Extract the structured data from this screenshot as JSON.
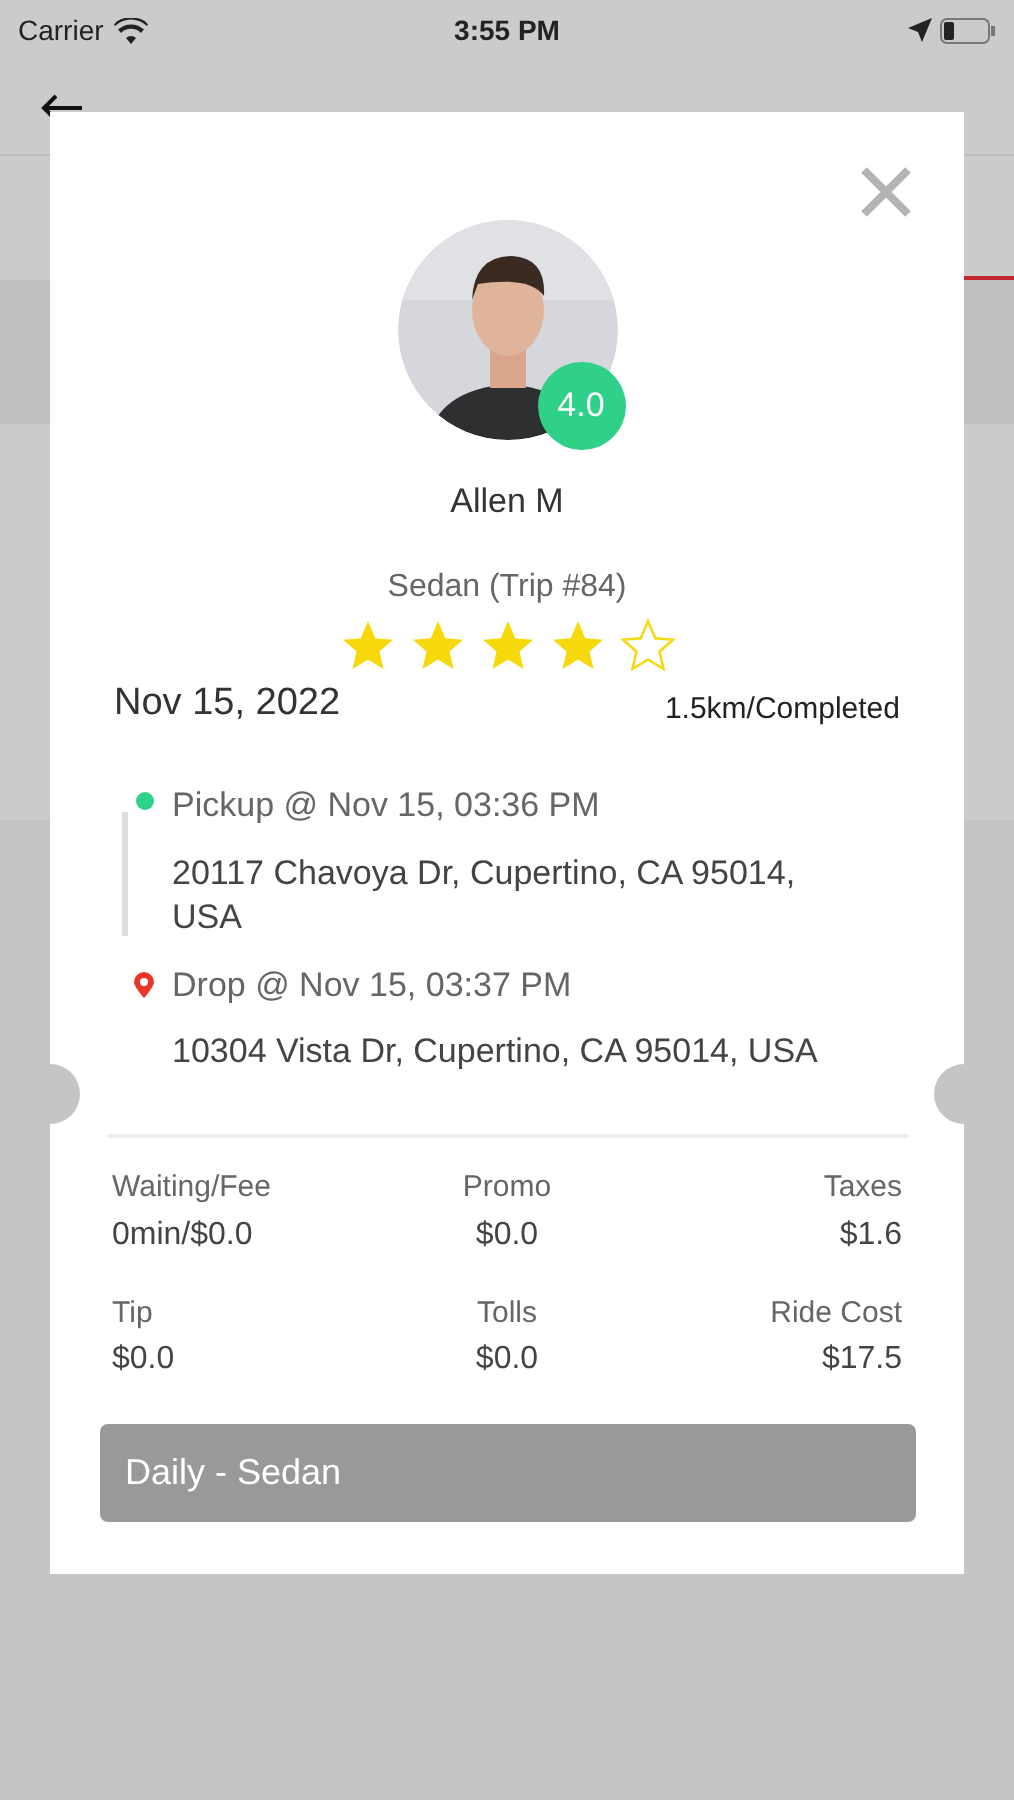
{
  "status_bar": {
    "carrier": "Carrier",
    "time": "3:55 PM"
  },
  "dialog": {
    "rating_badge": "4.0",
    "driver_name": "Allen M",
    "vehicle": "Sedan (Trip #84)",
    "stars": 4,
    "date": "Nov 15, 2022",
    "distance_status": "1.5km/Completed",
    "stops": [
      {
        "kind": "pickup",
        "label": "Pickup @ Nov 15, 03:36 PM",
        "address": "20117 Chavoya Dr, Cupertino, CA 95014, USA"
      },
      {
        "kind": "drop",
        "label": "Drop @ Nov 15, 03:37 PM",
        "address": "10304 Vista Dr, Cupertino, CA 95014, USA"
      }
    ],
    "fares": [
      {
        "label": "Waiting/Fee",
        "value": "0min/$0.0"
      },
      {
        "label": "Promo",
        "value": "$0.0"
      },
      {
        "label": "Taxes",
        "value": "$1.6"
      },
      {
        "label": "Tip",
        "value": "$0.0"
      },
      {
        "label": "Tolls",
        "value": "$0.0"
      },
      {
        "label": "Ride Cost",
        "value": "$17.5"
      }
    ],
    "plan": "Daily - Sedan"
  }
}
